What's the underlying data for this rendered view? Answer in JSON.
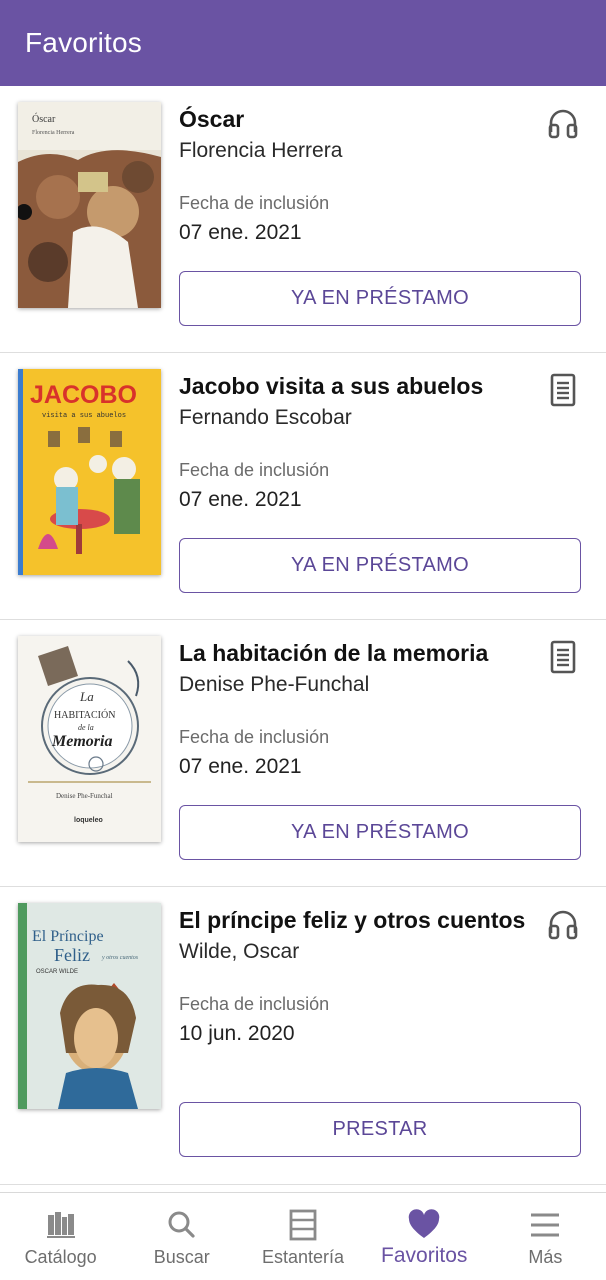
{
  "header": {
    "title": "Favoritos"
  },
  "colors": {
    "accent": "#6a53a3",
    "button_text": "#5b4797",
    "muted": "#6e6e6e"
  },
  "books": [
    {
      "title": "Óscar",
      "author": "Florencia Herrera",
      "date_label": "Fecha de inclusión",
      "date": "07 ene. 2021",
      "format_icon": "headphones-icon",
      "action_label": "YA EN PRÉSTAMO",
      "cover_text": [
        "Óscar",
        "Florencia Herrera"
      ]
    },
    {
      "title": "Jacobo visita a sus abuelos",
      "author": "Fernando Escobar",
      "date_label": "Fecha de inclusión",
      "date": "07 ene. 2021",
      "format_icon": "document-icon",
      "action_label": "YA EN PRÉSTAMO",
      "cover_text": [
        "JACOBO",
        "visita a sus abuelos"
      ]
    },
    {
      "title": "La habitación de la memoria",
      "author": "Denise Phe-Funchal",
      "date_label": "Fecha de inclusión",
      "date": "07 ene. 2021",
      "format_icon": "document-icon",
      "action_label": "YA EN PRÉSTAMO",
      "cover_text": [
        "La",
        "HABITACIÓN",
        "de la",
        "Memoria",
        "Denise Phe-Funchal",
        "loqueleo"
      ]
    },
    {
      "title": "El príncipe feliz y otros cuentos",
      "author": "Wilde, Oscar",
      "date_label": "Fecha de inclusión",
      "date": "10 jun. 2020",
      "format_icon": "headphones-icon",
      "action_label": "PRESTAR",
      "cover_text": [
        "El Príncipe",
        "Feliz",
        "y otros cuentos",
        "OSCAR WILDE"
      ]
    }
  ],
  "nav": [
    {
      "label": "Catálogo",
      "icon": "catalog-icon",
      "active": false
    },
    {
      "label": "Buscar",
      "icon": "search-icon",
      "active": false
    },
    {
      "label": "Estantería",
      "icon": "shelf-icon",
      "active": false
    },
    {
      "label": "Favoritos",
      "icon": "heart-icon",
      "active": true
    },
    {
      "label": "Más",
      "icon": "menu-icon",
      "active": false
    }
  ]
}
